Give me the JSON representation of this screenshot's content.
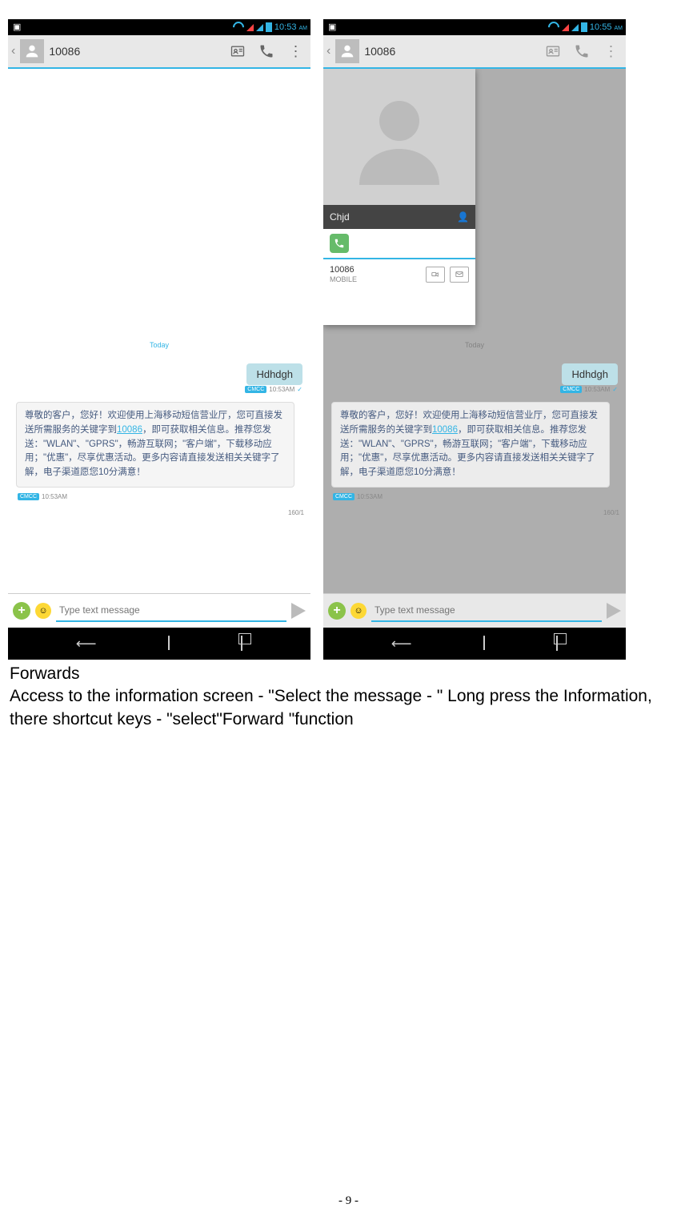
{
  "status": {
    "time_left": "10:53",
    "time_right": "10:55",
    "am": "AM"
  },
  "header": {
    "contact": "10086"
  },
  "conv": {
    "today": "Today",
    "out_msg": "Hdhdgh",
    "out_time": "10:53AM",
    "tag": "CMCC",
    "in_msg_pre": "尊敬的客户，您好！欢迎使用上海移动短信营业厅，您可直接发送所需服务的关键字到",
    "in_msg_link": "10086",
    "in_msg_post": "，即可获取相关信息。推荐您发送：\"WLAN\"、\"GPRS\"，畅游互联网；\"客户端\"，下载移动应用；\"优惠\"，尽享优惠活动。更多内容请直接发送相关关键字了解，电子渠道愿您10分满意！",
    "in_time": "10:53AM",
    "count": "160/1",
    "placeholder": "Type text message"
  },
  "popup": {
    "name": "Chjd",
    "number": "10086",
    "type": "MOBILE"
  },
  "doc": {
    "heading": "Forwards",
    "body": "Access to the information screen - \"Select the message - \" Long press the Information, there shortcut keys - \"select\"Forward \"function",
    "page": "- 9 -"
  }
}
